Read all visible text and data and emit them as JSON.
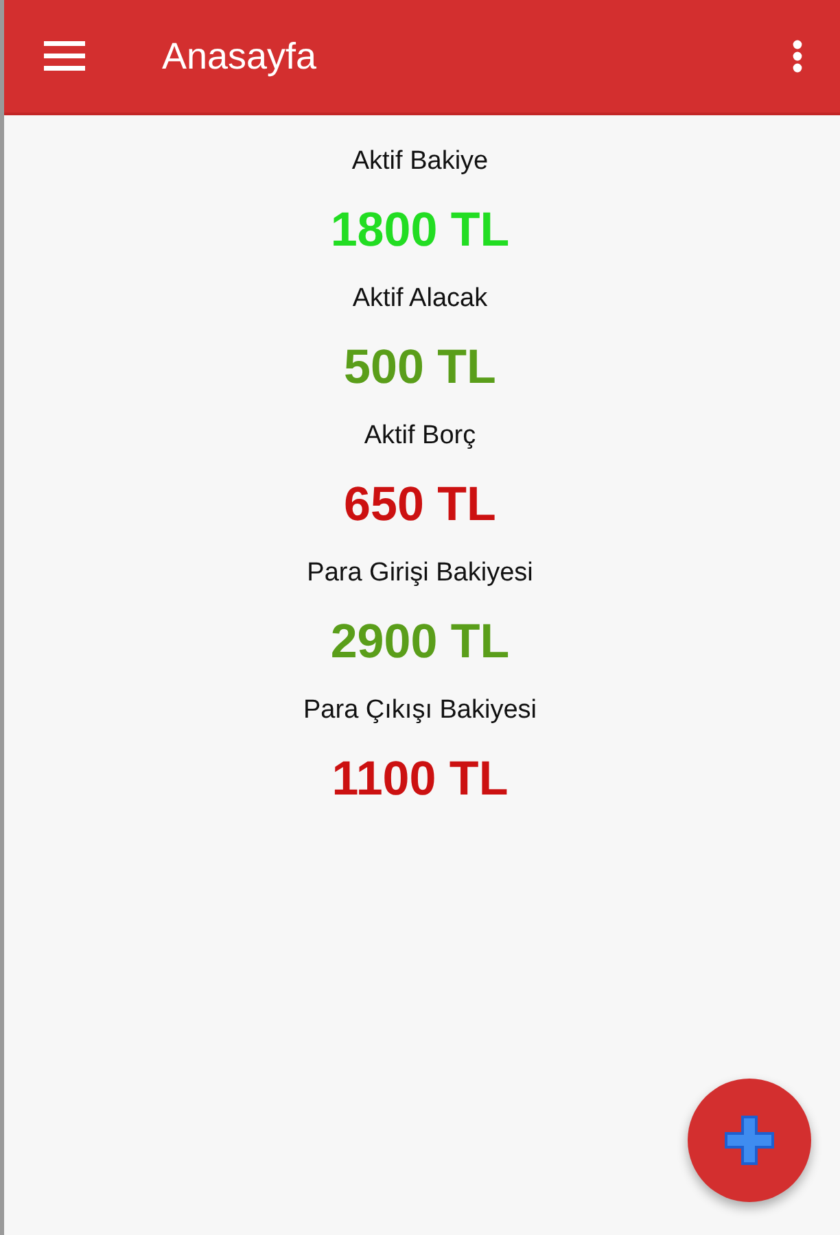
{
  "app_bar": {
    "title": "Anasayfa"
  },
  "balances": [
    {
      "label": "Aktif Bakiye",
      "value": "1800 TL",
      "color": "#22dd22"
    },
    {
      "label": "Aktif Alacak",
      "value": "500 TL",
      "color": "#5a9e1a"
    },
    {
      "label": "Aktif Borç",
      "value": "650 TL",
      "color": "#cc1111"
    },
    {
      "label": "Para Girişi Bakiyesi",
      "value": "2900 TL",
      "color": "#5a9e1a"
    },
    {
      "label": "Para Çıkışı Bakiyesi",
      "value": "1100 TL",
      "color": "#cc1111"
    }
  ]
}
